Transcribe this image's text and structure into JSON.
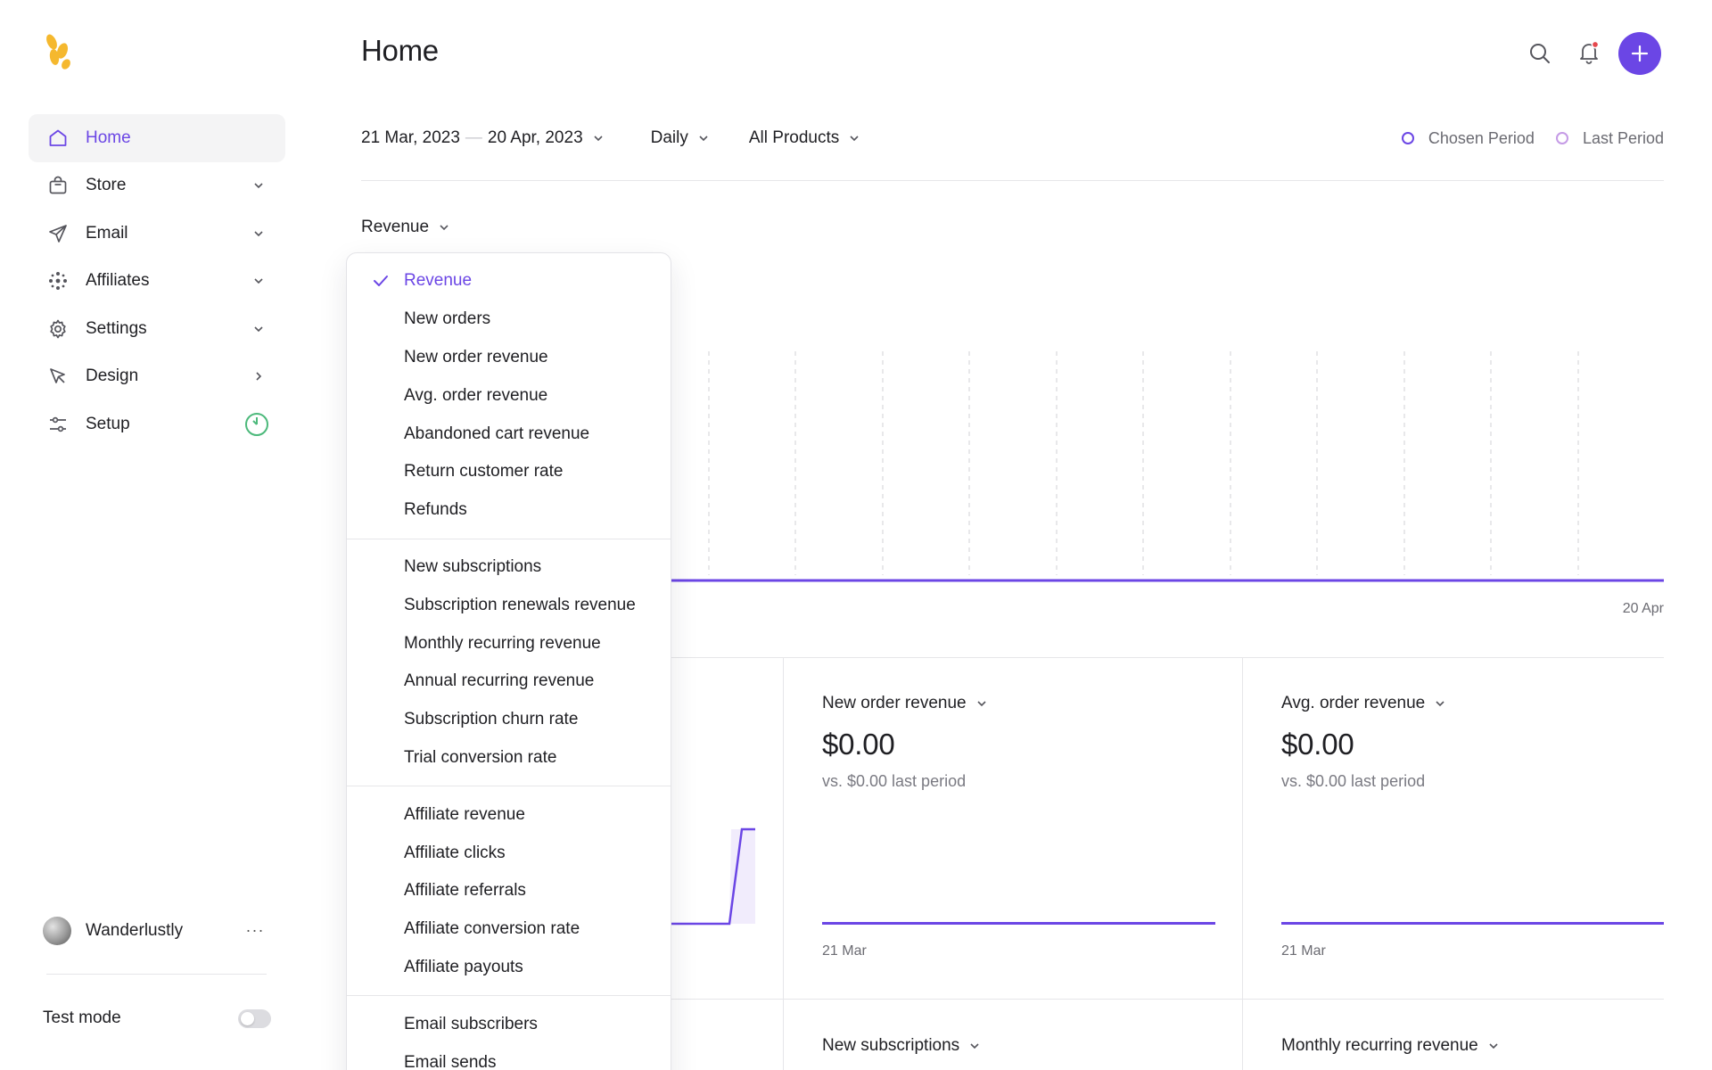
{
  "sidebar": {
    "items": [
      {
        "label": "Home",
        "icon": "home-icon",
        "active": true,
        "trail": "none"
      },
      {
        "label": "Store",
        "icon": "bag-icon",
        "trail": "chevron-down"
      },
      {
        "label": "Email",
        "icon": "send-icon",
        "trail": "chevron-down"
      },
      {
        "label": "Affiliates",
        "icon": "nodes-icon",
        "trail": "chevron-down"
      },
      {
        "label": "Settings",
        "icon": "gear-icon",
        "trail": "chevron-down"
      },
      {
        "label": "Design",
        "icon": "cursor-icon",
        "trail": "chevron-right"
      },
      {
        "label": "Setup",
        "icon": "sliders-icon",
        "trail": "progress-ring"
      }
    ],
    "user": {
      "name": "Wanderlustly",
      "more": "···"
    },
    "test_mode": {
      "label": "Test mode",
      "enabled": false
    }
  },
  "header": {
    "title": "Home"
  },
  "filters": {
    "date_start": "21 Mar, 2023",
    "date_sep": "—",
    "date_end": "20 Apr, 2023",
    "interval": "Daily",
    "products": "All Products"
  },
  "legend": {
    "chosen": "Chosen Period",
    "last": "Last Period"
  },
  "metric_select": {
    "label": "Revenue"
  },
  "main_chart": {
    "x_end_label": "20 Apr"
  },
  "dropdown": {
    "groups": [
      [
        "Revenue",
        "New orders",
        "New order revenue",
        "Avg. order revenue",
        "Abandoned cart revenue",
        "Return customer rate",
        "Refunds"
      ],
      [
        "New subscriptions",
        "Subscription renewals revenue",
        "Monthly recurring revenue",
        "Annual recurring revenue",
        "Subscription churn rate",
        "Trial conversion rate"
      ],
      [
        "Affiliate revenue",
        "Affiliate clicks",
        "Affiliate referrals",
        "Affiliate conversion rate",
        "Affiliate payouts"
      ],
      [
        "Email subscribers",
        "Email sends"
      ]
    ],
    "selected": "Revenue"
  },
  "cards": [
    {
      "title": "New order revenue",
      "value": "$0.00",
      "sub": "vs. $0.00 last period",
      "date": "21 Mar"
    },
    {
      "title": "Avg. order revenue",
      "value": "$0.00",
      "sub": "vs. $0.00 last period",
      "date": "21 Mar"
    }
  ],
  "cards_bottom": [
    {
      "title": "New subscriptions"
    },
    {
      "title": "Monthly recurring revenue"
    }
  ],
  "colors": {
    "accent": "#6b46e5",
    "chosen_dot": "#6b46e5",
    "last_dot": "#c59be6",
    "logo": "#f5b82e",
    "setup_ring": "#4cb97b",
    "notification_dot": "#e5484d"
  }
}
